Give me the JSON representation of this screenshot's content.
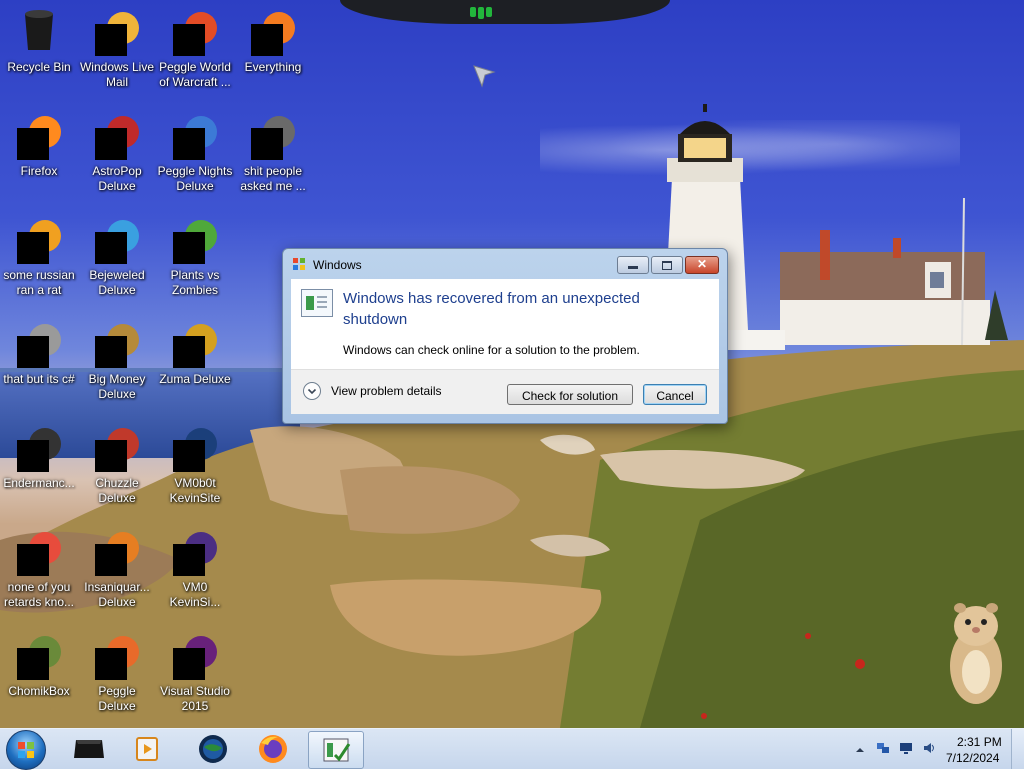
{
  "desktop": {
    "icons": [
      {
        "label": "Recycle Bin",
        "icon": "recycle-bin-icon"
      },
      {
        "label": "Windows Live\nMail",
        "icon": "mail-icon"
      },
      {
        "label": "Peggle World\nof Warcraft ...",
        "icon": "peggle-icon"
      },
      {
        "label": "Everything",
        "icon": "search-app-icon"
      },
      {
        "label": "Firefox",
        "icon": "firefox-icon"
      },
      {
        "label": "AstroPop\nDeluxe",
        "icon": "game-icon"
      },
      {
        "label": "Peggle Nights\nDeluxe",
        "icon": "peggle-icon"
      },
      {
        "label": "shit people\nasked me ...",
        "icon": "folder-icon"
      },
      {
        "label": "some russian\nran a rat",
        "icon": "app-icon"
      },
      {
        "label": "Bejeweled\nDeluxe",
        "icon": "gem-icon"
      },
      {
        "label": "Plants vs\nZombies",
        "icon": "game-icon"
      },
      {
        "label": "that but its c#",
        "icon": "shortcut-icon"
      },
      {
        "label": "Big Money\nDeluxe",
        "icon": "game-icon"
      },
      {
        "label": "Zuma Deluxe",
        "icon": "game-icon"
      },
      {
        "label": "Endermanc...",
        "icon": "app-icon"
      },
      {
        "label": "Chuzzle\nDeluxe",
        "icon": "game-icon"
      },
      {
        "label": "VM0b0t\nKevinSite",
        "icon": "app-icon"
      },
      {
        "label": "none of you\nretards kno...",
        "icon": "app-icon"
      },
      {
        "label": "Insaniquar...\nDeluxe",
        "icon": "game-icon"
      },
      {
        "label": "VM0\nKevinSi...",
        "icon": "app-icon"
      },
      {
        "label": "ChomikBox",
        "icon": "app-icon"
      },
      {
        "label": "Peggle Deluxe",
        "icon": "peggle-icon"
      },
      {
        "label": "Visual Studio\n2015",
        "icon": "visual-studio-icon"
      }
    ]
  },
  "dialog": {
    "title": "Windows",
    "heading": "Windows has recovered from an unexpected shutdown",
    "message": "Windows can check online for a solution to the problem.",
    "details_label": "View problem details",
    "check_button": "Check for solution",
    "cancel_button": "Cancel"
  },
  "taskbar": {
    "items": [
      "media-player-icon",
      "windows-media-center-icon",
      "globe-icon",
      "firefox-icon",
      "problem-reports-icon"
    ],
    "tray": {
      "time": "2:31 PM",
      "date": "7/12/2024"
    }
  },
  "colors": {
    "dialog_heading": "#1e3f8e",
    "taskbar": "#c6d6ec",
    "sky": "#3f55d2"
  }
}
